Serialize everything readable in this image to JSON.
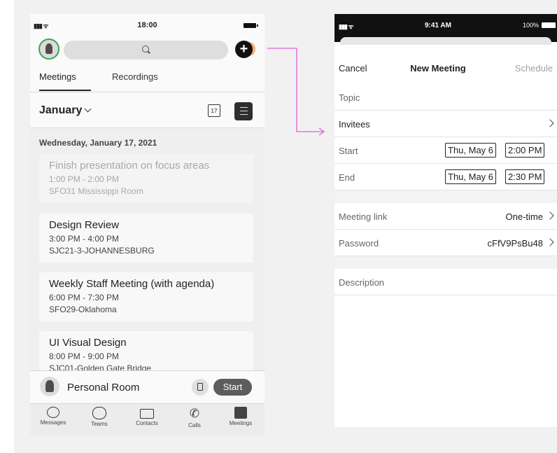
{
  "left_phone": {
    "status_time": "18:00",
    "tabs": [
      {
        "label": "Meetings",
        "active": true
      },
      {
        "label": "Recordings",
        "active": false
      }
    ],
    "calendar": {
      "month": "January",
      "icon_day": "17"
    },
    "day_header": "Wednesday, January 17, 2021",
    "meetings": [
      {
        "title": "Finish presentation on focus areas",
        "time": "1:00 PM - 2:00 PM",
        "location": "SFO31 Mississippi Room",
        "past": true
      },
      {
        "title": "Design Review",
        "time": "3:00 PM - 4:00 PM",
        "location": "SJC21-3-JOHANNESBURG",
        "past": false
      },
      {
        "title": "Weekly Staff Meeting (with agenda)",
        "time": "6:00 PM - 7:30 PM",
        "location": "SFO29-Oklahoma",
        "past": false
      },
      {
        "title": "UI Visual Design",
        "time": "8:00 PM - 9:00 PM",
        "location": "SJC01-Golden Gate Bridge",
        "past": false
      }
    ],
    "personal_room": {
      "label": "Personal Room",
      "start": "Start"
    },
    "bottom_nav": [
      {
        "label": "Messages",
        "icon": "chat-bubble-icon"
      },
      {
        "label": "Teams",
        "icon": "teams-icon"
      },
      {
        "label": "Contacts",
        "icon": "contact-card-icon"
      },
      {
        "label": "Calls",
        "icon": "phone-icon"
      },
      {
        "label": "Meetings",
        "icon": "calendar-icon"
      }
    ]
  },
  "right_phone": {
    "status": {
      "time": "9:41 AM",
      "battery": "100%"
    },
    "nav": {
      "cancel": "Cancel",
      "title": "New Meeting",
      "schedule": "Schedule"
    },
    "fields": {
      "topic": "Topic",
      "invitees": "Invitees",
      "start_label": "Start",
      "start_date": "Thu, May 6",
      "start_time": "2:00 PM",
      "end_label": "End",
      "end_date": "Thu, May 6",
      "end_time": "2:30 PM",
      "meeting_link_label": "Meeting link",
      "meeting_link_value": "One-time",
      "password_label": "Password",
      "password_value": "cFfV9PsBu48",
      "description": "Description"
    }
  },
  "colors": {
    "arrow": "#e05fd8",
    "avatar_ring": "#3aa655",
    "accent_orange": "#f2a46b"
  }
}
